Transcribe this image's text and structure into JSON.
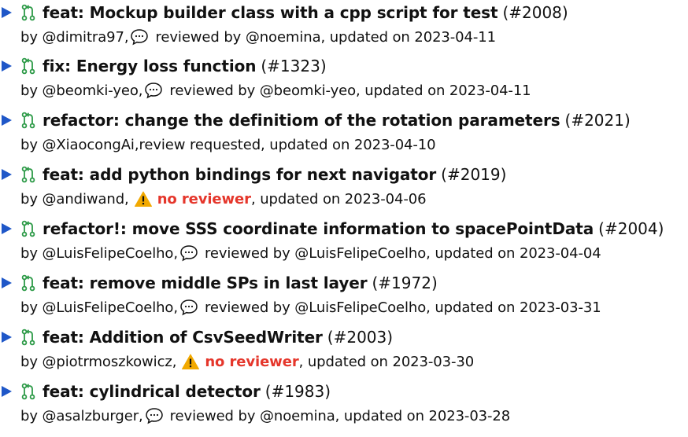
{
  "colors": {
    "triangle": "#1f57c8",
    "pr_icon": "#2c9a47",
    "warning": "#f2a900",
    "no_reviewer": "#e5362b"
  },
  "items": [
    {
      "title": "feat: Mockup builder class with a cpp script for test",
      "number": "(#2008)",
      "author": "by @dimitra97,",
      "review_type": "reviewed",
      "review_text": "reviewed by @noemina, updated on 2023-04-11"
    },
    {
      "title": "fix: Energy loss function",
      "number": "(#1323)",
      "author": "by @beomki-yeo,",
      "review_type": "reviewed",
      "review_text": "reviewed by @beomki-yeo, updated on 2023-04-11"
    },
    {
      "title": "refactor: change the definitiom of the rotation parameters",
      "number": "(#2021)",
      "author": "by @XiaocongAi,",
      "review_type": "requested",
      "review_text": "review requested, updated on 2023-04-10"
    },
    {
      "title": "feat: add python bindings for next navigator",
      "number": "(#2019)",
      "author": "by @andiwand,",
      "review_type": "none",
      "no_reviewer": "no reviewer",
      "review_text": ", updated on 2023-04-06"
    },
    {
      "title": "refactor!: move SSS coordinate information to spacePointData",
      "number": "(#2004)",
      "author": "by @LuisFelipeCoelho,",
      "review_type": "reviewed",
      "review_text": "reviewed by @LuisFelipeCoelho, updated on 2023-04-04"
    },
    {
      "title": "feat: remove middle SPs in last layer",
      "number": "(#1972)",
      "author": "by @LuisFelipeCoelho,",
      "review_type": "reviewed",
      "review_text": "reviewed by @LuisFelipeCoelho, updated on 2023-03-31"
    },
    {
      "title": "feat: Addition of CsvSeedWriter",
      "number": "(#2003)",
      "author": "by @piotrmoszkowicz,",
      "review_type": "none",
      "no_reviewer": "no reviewer",
      "review_text": ", updated on 2023-03-30"
    },
    {
      "title": "feat: cylindrical detector",
      "number": "(#1983)",
      "author": "by @asalzburger,",
      "review_type": "reviewed",
      "review_text": "reviewed by @noemina, updated on 2023-03-28"
    }
  ]
}
